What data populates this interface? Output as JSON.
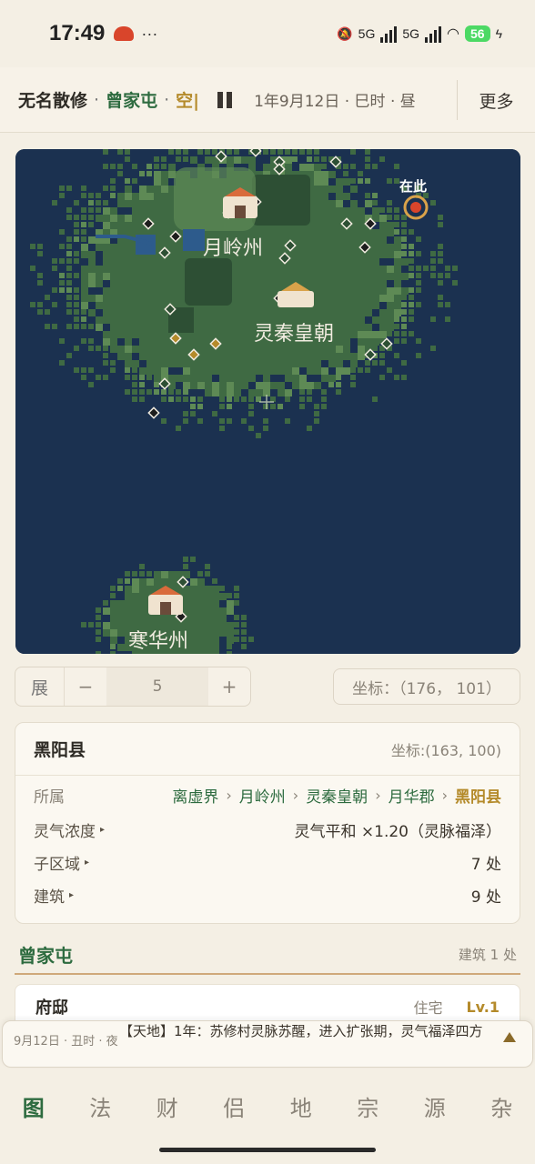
{
  "status_bar": {
    "time": "17:49",
    "dots": "···",
    "net1": "5G",
    "net2": "5G",
    "battery": "56"
  },
  "header": {
    "name": "无名散修",
    "sep": "·",
    "location": "曾家屯",
    "state": "空|",
    "date": "1年9月12日 · 巳时 · 昼",
    "more_label": "更多"
  },
  "map": {
    "labels": {
      "yueling": "月岭州",
      "lingqin": "灵秦皇朝",
      "hanhua": "寒华州",
      "here": "在此"
    },
    "colors": {
      "ocean": "#1b3150",
      "land": "#3f6a43",
      "land_light": "#5e8a55",
      "forest": "#2d4f34",
      "lake": "#2d5b8c"
    }
  },
  "zoom": {
    "label": "展",
    "minus": "−",
    "value": "5",
    "plus": "+"
  },
  "coord_display": "坐标：（176， 101）",
  "detail": {
    "title": "黑阳县",
    "coord": "坐标:(163, 100)",
    "belong_label": "所属",
    "breadcrumbs": [
      "离虚界",
      "月岭州",
      "灵秦皇朝",
      "月华郡",
      "黑阳县"
    ],
    "qi_label": "灵气浓度",
    "qi_value": "灵气平和 ×1.20（灵脉福泽）",
    "subregion_label": "子区域",
    "subregion_value": "7 处",
    "building_label": "建筑",
    "building_value": "9 处"
  },
  "section": {
    "title": "曾家屯",
    "meta": "建筑 1 处"
  },
  "building": {
    "name": "府邸",
    "type": "住宅",
    "level": "Lv.1"
  },
  "log": {
    "time": "9月12日 · 丑时 · 夜",
    "text": "【天地】1年：苏修村灵脉苏醒，进入扩张期，灵气福泽四方"
  },
  "nav": [
    "图",
    "法",
    "财",
    "侣",
    "地",
    "宗",
    "源",
    "杂"
  ]
}
